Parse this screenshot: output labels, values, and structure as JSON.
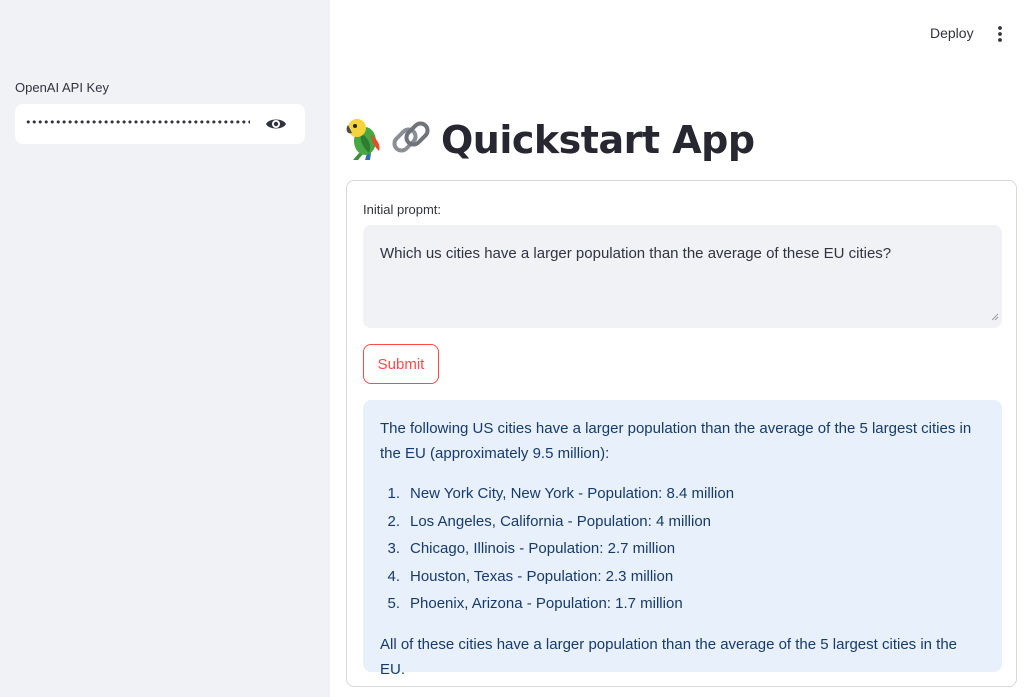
{
  "sidebar": {
    "api_key_label": "OpenAI API Key",
    "api_key_masked": "••••••••••••••••••••••••••••••••••••••••••••••••••••••",
    "eye_icon": "eye-icon"
  },
  "header": {
    "deploy_label": "Deploy",
    "menu_icon": "kebab-menu-icon"
  },
  "page": {
    "title": "Quickstart App",
    "title_icons": [
      "parrot-icon",
      "link-icon"
    ]
  },
  "form": {
    "prompt_label": "Initial propmt:",
    "prompt_value": "Which us cities have a larger population than the average of these EU cities?",
    "submit_label": "Submit"
  },
  "answer": {
    "intro": "The following US cities have a larger population than the average of the 5 largest cities in the EU (approximately 9.5 million):",
    "items": [
      {
        "num": "1.",
        "text": "New York City, New York - Population: 8.4 million"
      },
      {
        "num": "2.",
        "text": "Los Angeles, California - Population: 4 million"
      },
      {
        "num": "3.",
        "text": "Chicago, Illinois - Population: 2.7 million"
      },
      {
        "num": "4.",
        "text": "Houston, Texas - Population: 2.3 million"
      },
      {
        "num": "5.",
        "text": "Phoenix, Arizona - Population: 1.7 million"
      }
    ],
    "conclusion": "All of these cities have a larger population than the average of the 5 largest cities in the EU."
  },
  "colors": {
    "sidebar_bg": "#f0f2f6",
    "accent": "#ff4b4b",
    "info_bg": "#e8f0fc",
    "info_text": "#163b6b"
  }
}
